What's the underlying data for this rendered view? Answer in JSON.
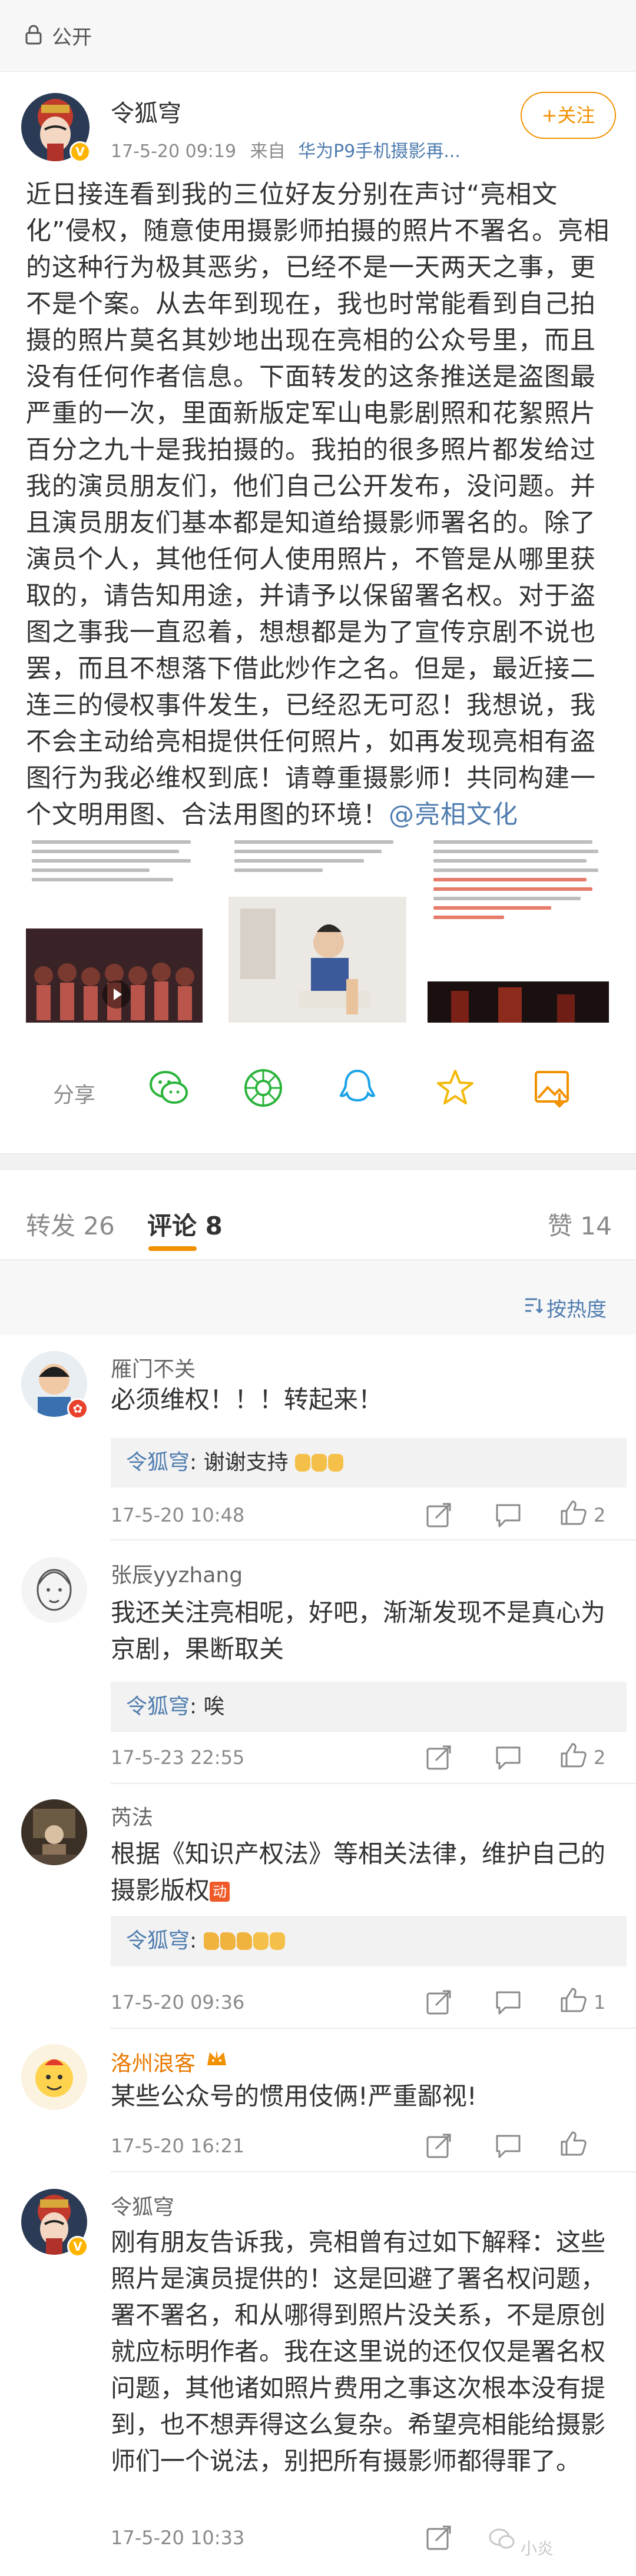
{
  "topbar": {
    "label": "公开"
  },
  "post": {
    "author": "令狐穹",
    "time": "17-5-20 09:19",
    "source_prefix": "来自",
    "source": "华为P9手机摄影再...",
    "follow_label": "+关注",
    "text_before_mention": "近日接连看到我的三位好友分别在声讨“亮相文化”侵权，随意使用摄影师拍摄的照片不署名。亮相的这种行为极其恶劣，已经不是一天两天之事，更不是个案。从去年到现在，我也时常能看到自己拍摄的照片莫名其妙地出现在亮相的公众号里，而且没有任何作者信息。下面转发的这条推送是盗图最严重的一次，里面新版定军山电影剧照和花絮照片百分之九十是我拍摄的。我拍的很多照片都发给过我的演员朋友们，他们自己公开发布，没问题。并且演员朋友们基本都是知道给摄影师署名的。除了演员个人，其他任何人使用照片，不管是从哪里获取的，请告知用途，并请予以保留署名权。对于盗图之事我一直忍着，想想都是为了宣传京剧不说也罢，而且不想落下借此炒作之名。但是，最近接二连三的侵权事件发生，已经忍无可忍！我想说，我不会主动给亮相提供任何照片，如再发现亮相有盗图行为我必维权到底！请尊重摄影师！共同构建一个文明用图、合法用图的环境！",
    "mention": "@亮相文化"
  },
  "share": {
    "label": "分享"
  },
  "tabs": {
    "repost": "转发 26",
    "comments": "评论 8",
    "likes": "赞 14"
  },
  "sort_label": "按热度",
  "comments": [
    {
      "name": "雁门不关",
      "text": "必须维权！！！转起来！",
      "reply_name": "令狐穹",
      "reply_text": "谢谢支持",
      "time": "17-5-20 10:48",
      "likes": "2"
    },
    {
      "name": "张辰yyzhang",
      "text": "我还关注亮相呢，好吧，渐渐发现不是真心为京剧，果断取关",
      "reply_name": "令狐穹",
      "reply_text": "唉",
      "time": "17-5-23 22:55",
      "likes": "2"
    },
    {
      "name": "芮法",
      "text": "根据《知识产权法》等相关法律，维护自己的摄影版权",
      "badge": "动",
      "reply_name": "令狐穹",
      "reply_text": "",
      "time": "17-5-20 09:36",
      "likes": "1"
    },
    {
      "name": "洛州浪客",
      "text": "某些公众号的惯用伎俩!严重鄙视!",
      "time": "17-5-20 16:21",
      "likes": ""
    },
    {
      "name": "令狐穹",
      "text": "刚有朋友告诉我，亮相曾有过如下解释：这些照片是演员提供的！这是回避了署名权问题，署不署名，和从哪得到照片没关系，不是原创就应标明作者。我在这里说的还仅仅是署名权问题，其他诸如照片费用之事这次根本没有提到，也不想弄得这么复杂。希望亮相能给摄影师们一个说法，别把所有摄影师都得罪了。",
      "time": "17-5-20 10:33",
      "likes": ""
    }
  ],
  "watermark": "小炎",
  "colors": {
    "accent_orange": "#f29100",
    "link_blue": "#507daf",
    "meta_gray": "#8a8a8a"
  }
}
